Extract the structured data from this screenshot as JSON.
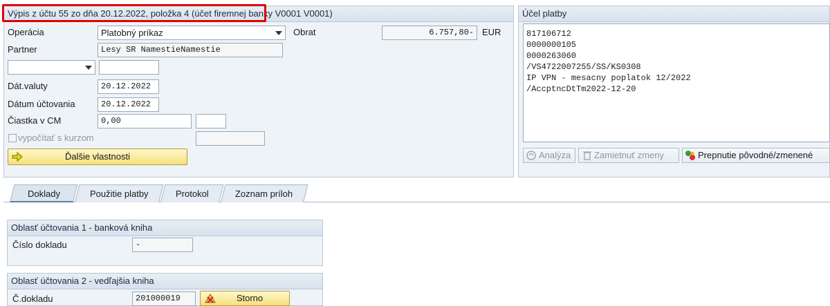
{
  "banner_title": "Výpis z účtu 55 zo dňa 20.12.2022, položka 4 (účet firemnej banky V0001 V0001)",
  "fields": {
    "operacia_label": "Operácia",
    "operacia_value": "Platobný príkaz",
    "obrat_label": "Obrat",
    "obrat_value": "6.757,80-",
    "currency": "EUR",
    "partner_label": "Partner",
    "partner_value": "Lesy SR NamestieNamestie",
    "dat_valuty_label": "Dát.valuty",
    "dat_valuty_value": "20.12.2022",
    "datum_uctovania_label": "Dátum účtovania",
    "datum_uctovania_value": "20.12.2022",
    "ciastka_label": "Čiastka v CM",
    "ciastka_value": "0,00",
    "vypocitat_label": "vypočítať s kurzom",
    "dalsie_btn": "Ďalšie vlastnosti"
  },
  "ucel_platby": {
    "title": "Účel platby",
    "lines": [
      "817106712",
      "0000000105",
      "0000263060",
      "/VS4722007255/SS/KS0308",
      "IP VPN - mesacny poplatok 12/2022",
      "/AccptncDtTm2022-12-20"
    ],
    "btn_analyza": "Analýza",
    "btn_zamietnut": "Zamietnuť zmeny",
    "btn_prepnutie": "Prepnutie pôvodné/zmenené"
  },
  "tabs": [
    "Doklady",
    "Použitie platby",
    "Protokol",
    "Zoznam príloh"
  ],
  "oblast1": {
    "title": "Oblasť účtovania 1 - banková kniha",
    "cislo_label": "Číslo dokladu",
    "cislo_value": "-"
  },
  "oblast2": {
    "title": "Oblasť účtovania 2 - vedľajšia kniha",
    "cislo_label": "Č.dokladu",
    "cislo_value": "201000019",
    "storno_btn": "Storno"
  },
  "colors": {
    "highlight": "#e00000",
    "panel": "#eef3f8",
    "button_yellow": "#f7df7a"
  }
}
